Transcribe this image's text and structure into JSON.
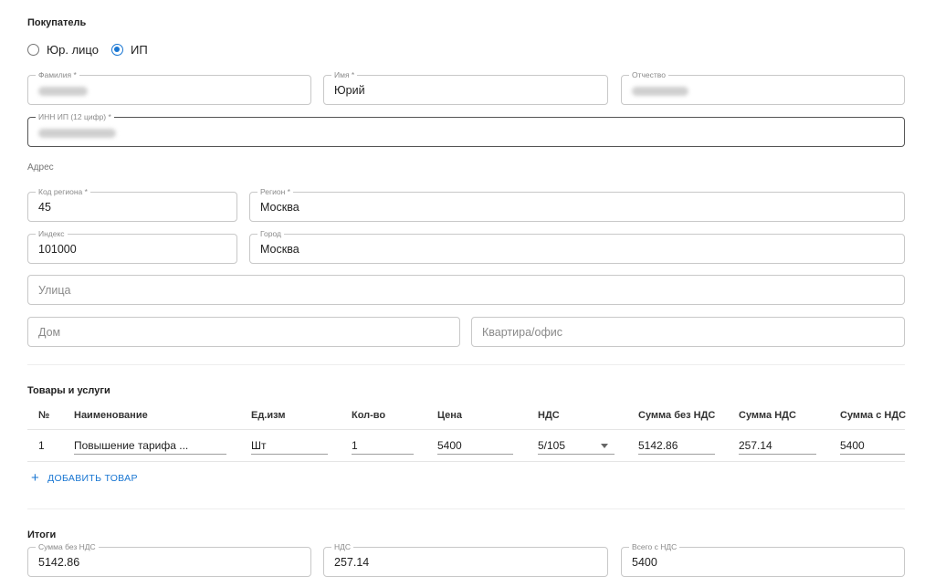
{
  "buyer": {
    "title": "Покупатель",
    "type_options": [
      {
        "label": "Юр. лицо",
        "checked": false
      },
      {
        "label": "ИП",
        "checked": true
      }
    ],
    "surname_label": "Фамилия *",
    "name_label": "Имя *",
    "name_value": "Юрий",
    "patronymic_label": "Отчество",
    "inn_label": "ИНН ИП (12 цифр) *"
  },
  "address": {
    "title": "Адрес",
    "region_code_label": "Код региона *",
    "region_code_value": "45",
    "region_label": "Регион *",
    "region_value": "Москва",
    "index_label": "Индекс",
    "index_value": "101000",
    "city_label": "Город",
    "city_value": "Москва",
    "street_placeholder": "Улица",
    "house_placeholder": "Дом",
    "apartment_placeholder": "Квартира/офис"
  },
  "goods": {
    "title": "Товары и услуги",
    "columns": [
      "№",
      "Наименование",
      "Ед.изм",
      "Кол-во",
      "Цена",
      "НДС",
      "Сумма без НДС",
      "Сумма НДС",
      "Сумма с НДС"
    ],
    "rows": [
      {
        "num": "1",
        "name": "Повышение тарифа ...",
        "unit": "Шт",
        "qty": "1",
        "price": "5400",
        "vat": "5/105",
        "sum_no_vat": "5142.86",
        "vat_sum": "257.14",
        "sum_with_vat": "5400"
      }
    ],
    "add_button": "ДОБАВИТЬ ТОВАР"
  },
  "totals": {
    "title": "Итоги",
    "sum_no_vat_label": "Сумма без НДС",
    "sum_no_vat_value": "5142.86",
    "vat_label": "НДС",
    "vat_value": "257.14",
    "total_label": "Всего с НДС",
    "total_value": "5400"
  },
  "colors": {
    "accent": "#1976d2",
    "border": "#c8c8c8",
    "focused_border": "#555555"
  }
}
